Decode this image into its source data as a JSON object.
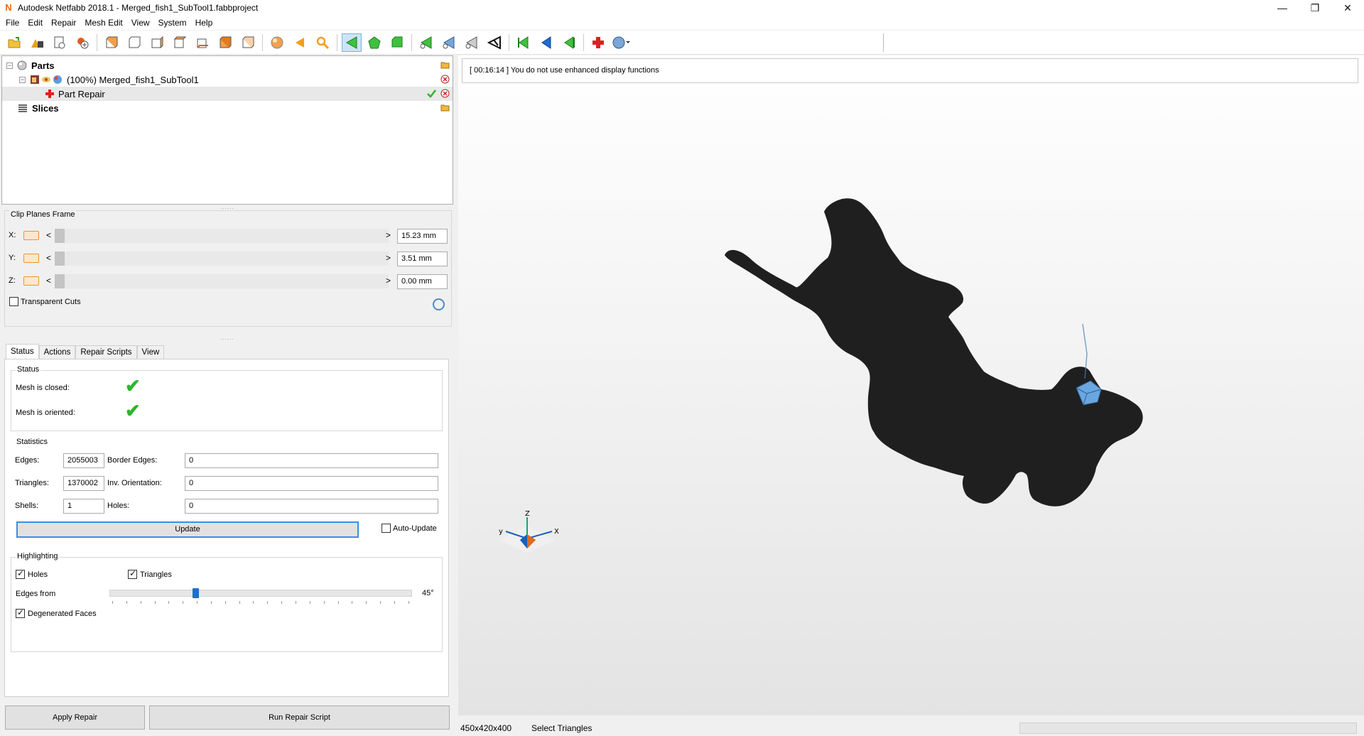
{
  "window": {
    "title": "Autodesk Netfabb 2018.1 - Merged_fish1_SubTool1.fabbproject",
    "app_icon": "netfabb-n-icon",
    "controls": {
      "minimize": "—",
      "restore": "❐",
      "close": "✕"
    }
  },
  "menu": [
    "File",
    "Edit",
    "Repair",
    "Mesh Edit",
    "View",
    "System",
    "Help"
  ],
  "toolbar": {
    "icons": [
      "open-project-icon",
      "add-part-icon",
      "new-icon",
      "add-icon",
      "view-front-icon",
      "view-back-icon",
      "view-left-icon",
      "view-right-icon",
      "view-top-icon",
      "view-bottom-icon",
      "view-iso-icon",
      "sphere-icon",
      "back-arrow-icon",
      "zoom-icon",
      "select-triangles-icon",
      "select-shell-icon",
      "select-surface-icon",
      "add-triangle-icon",
      "remove-triangle-icon",
      "cut-icon",
      "split-icon",
      "green-left-icon",
      "blue-left-icon",
      "green-right-icon",
      "repair-cross-icon",
      "help-icon"
    ]
  },
  "tree": {
    "parts_label": "Parts",
    "part_label": "(100%) Merged_fish1_SubTool1",
    "repair_label": "Part Repair",
    "slices_label": "Slices"
  },
  "clip": {
    "title": "Clip Planes Frame",
    "rows": [
      {
        "axis": "X:",
        "value": "15.23 mm"
      },
      {
        "axis": "Y:",
        "value": "3.51 mm"
      },
      {
        "axis": "Z:",
        "value": "0.00 mm"
      }
    ],
    "transparent_cuts": "Transparent Cuts",
    "arrow_left": "<",
    "arrow_right": ">"
  },
  "tabs": [
    "Status",
    "Actions",
    "Repair Scripts",
    "View"
  ],
  "status": {
    "group_title": "Status",
    "mesh_closed": "Mesh is closed:",
    "mesh_oriented": "Mesh is oriented:",
    "check": "✔"
  },
  "statistics": {
    "group_title": "Statistics",
    "edges_label": "Edges:",
    "edges": "2055003",
    "border_edges_label": "Border Edges:",
    "border_edges": "0",
    "triangles_label": "Triangles:",
    "triangles": "1370002",
    "inv_orientation_label": "Inv. Orientation:",
    "inv_orientation": "0",
    "shells_label": "Shells:",
    "shells": "1",
    "holes_label": "Holes:",
    "holes": "0",
    "update_label": "Update",
    "auto_update_label": "Auto-Update"
  },
  "highlighting": {
    "group_title": "Highlighting",
    "holes_label": "Holes",
    "triangles_label": "Triangles",
    "edges_from_label": "Edges from",
    "edges_from_value": "45°",
    "edges_from_level": 0.28,
    "degenerated_label": "Degenerated Faces"
  },
  "buttons": {
    "apply_repair": "Apply Repair",
    "run_repair_script": "Run Repair Script"
  },
  "viewport": {
    "log_message": "[ 00:16:14 ] You do not use enhanced display functions",
    "axes": {
      "z": "Z",
      "y": "y",
      "x": "X"
    },
    "mesh_color": "#202020",
    "highlight_color": "#6aa7e0"
  },
  "statusbar": {
    "dimensions": "450x420x400",
    "mode": "Select Triangles"
  },
  "colors": {
    "accent": "#3a8ee6",
    "check_green": "#2db52d",
    "plane_orange": "#e8962c"
  }
}
